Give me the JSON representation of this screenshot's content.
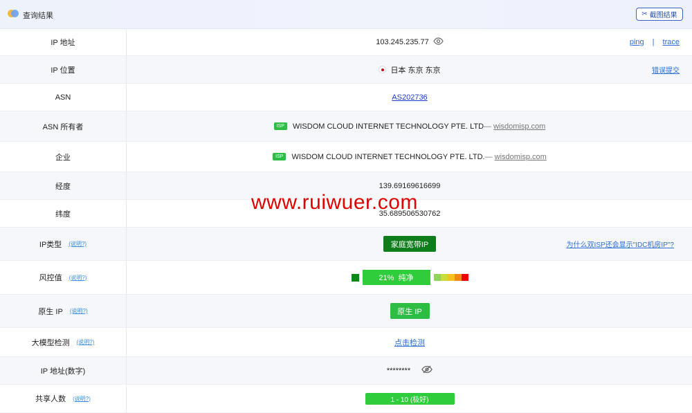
{
  "header": {
    "title": "查询结果",
    "screenshot_button": "截图结果"
  },
  "rows": {
    "ip": {
      "label": "IP 地址",
      "value": "103.245.235.77",
      "ping": "ping",
      "sep": "|",
      "trace": "trace"
    },
    "location": {
      "label": "IP 位置",
      "value": "日本 东京 东京",
      "report": "错误提交"
    },
    "asn": {
      "label": "ASN",
      "value": "AS202736"
    },
    "asn_owner": {
      "label": "ASN 所有者",
      "badge": "ISP",
      "name": "WISDOM CLOUD INTERNET TECHNOLOGY PTE. LTD",
      "dash": "— ",
      "domain": "wisdomisp.com"
    },
    "company": {
      "label": "企业",
      "badge": "ISP",
      "name": "WISDOM CLOUD INTERNET TECHNOLOGY PTE. LTD.",
      "dash": "— ",
      "domain": "wisdomisp.com"
    },
    "longitude": {
      "label": "经度",
      "value": "139.69169616699"
    },
    "latitude": {
      "label": "纬度",
      "value": "35.689506530762"
    },
    "ip_type": {
      "label": "IP类型",
      "help": "(说明?)",
      "value": "家庭宽带IP",
      "question": "为什么双ISP还会显示\"IDC机房IP\"?"
    },
    "risk": {
      "label": "风控值",
      "help": "(说明?)",
      "value": "21%  纯净",
      "percent": 21
    },
    "native": {
      "label": "原生 IP",
      "help": "(说明?)",
      "value": "原生 IP"
    },
    "llm": {
      "label": "大模型检测",
      "help": "(说明?)",
      "value": "点击检测"
    },
    "ip_numeric": {
      "label": "IP 地址(数字)",
      "value": "********"
    },
    "shared": {
      "label": "共享人数",
      "help": "(说明?)",
      "value": "1 - 10 (极好)"
    }
  },
  "watermark": "www.ruiwuer.com",
  "colors": {
    "accent": "#2b6dd6",
    "green_dark": "#0e7d1c",
    "green": "#2dbd44",
    "risk_scale": [
      "#8fd45b",
      "#c9dc3a",
      "#f4c21a",
      "#f08a10",
      "#ee0000"
    ]
  }
}
